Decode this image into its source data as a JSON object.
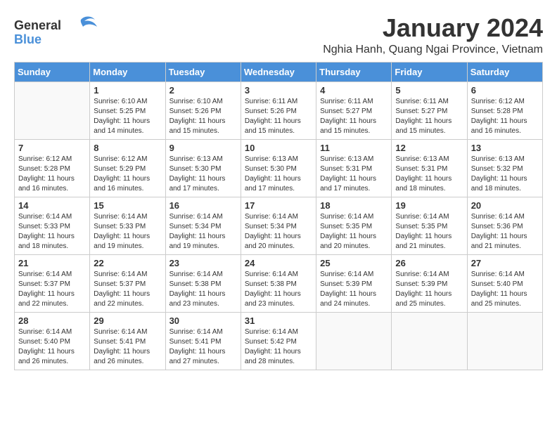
{
  "header": {
    "logo_general": "General",
    "logo_blue": "Blue",
    "month": "January 2024",
    "location": "Nghia Hanh, Quang Ngai Province, Vietnam"
  },
  "weekdays": [
    "Sunday",
    "Monday",
    "Tuesday",
    "Wednesday",
    "Thursday",
    "Friday",
    "Saturday"
  ],
  "weeks": [
    [
      {
        "day": "",
        "sunrise": "",
        "sunset": "",
        "daylight": ""
      },
      {
        "day": "1",
        "sunrise": "Sunrise: 6:10 AM",
        "sunset": "Sunset: 5:25 PM",
        "daylight": "Daylight: 11 hours and 14 minutes."
      },
      {
        "day": "2",
        "sunrise": "Sunrise: 6:10 AM",
        "sunset": "Sunset: 5:26 PM",
        "daylight": "Daylight: 11 hours and 15 minutes."
      },
      {
        "day": "3",
        "sunrise": "Sunrise: 6:11 AM",
        "sunset": "Sunset: 5:26 PM",
        "daylight": "Daylight: 11 hours and 15 minutes."
      },
      {
        "day": "4",
        "sunrise": "Sunrise: 6:11 AM",
        "sunset": "Sunset: 5:27 PM",
        "daylight": "Daylight: 11 hours and 15 minutes."
      },
      {
        "day": "5",
        "sunrise": "Sunrise: 6:11 AM",
        "sunset": "Sunset: 5:27 PM",
        "daylight": "Daylight: 11 hours and 15 minutes."
      },
      {
        "day": "6",
        "sunrise": "Sunrise: 6:12 AM",
        "sunset": "Sunset: 5:28 PM",
        "daylight": "Daylight: 11 hours and 16 minutes."
      }
    ],
    [
      {
        "day": "7",
        "sunrise": "Sunrise: 6:12 AM",
        "sunset": "Sunset: 5:28 PM",
        "daylight": "Daylight: 11 hours and 16 minutes."
      },
      {
        "day": "8",
        "sunrise": "Sunrise: 6:12 AM",
        "sunset": "Sunset: 5:29 PM",
        "daylight": "Daylight: 11 hours and 16 minutes."
      },
      {
        "day": "9",
        "sunrise": "Sunrise: 6:13 AM",
        "sunset": "Sunset: 5:30 PM",
        "daylight": "Daylight: 11 hours and 17 minutes."
      },
      {
        "day": "10",
        "sunrise": "Sunrise: 6:13 AM",
        "sunset": "Sunset: 5:30 PM",
        "daylight": "Daylight: 11 hours and 17 minutes."
      },
      {
        "day": "11",
        "sunrise": "Sunrise: 6:13 AM",
        "sunset": "Sunset: 5:31 PM",
        "daylight": "Daylight: 11 hours and 17 minutes."
      },
      {
        "day": "12",
        "sunrise": "Sunrise: 6:13 AM",
        "sunset": "Sunset: 5:31 PM",
        "daylight": "Daylight: 11 hours and 18 minutes."
      },
      {
        "day": "13",
        "sunrise": "Sunrise: 6:13 AM",
        "sunset": "Sunset: 5:32 PM",
        "daylight": "Daylight: 11 hours and 18 minutes."
      }
    ],
    [
      {
        "day": "14",
        "sunrise": "Sunrise: 6:14 AM",
        "sunset": "Sunset: 5:33 PM",
        "daylight": "Daylight: 11 hours and 18 minutes."
      },
      {
        "day": "15",
        "sunrise": "Sunrise: 6:14 AM",
        "sunset": "Sunset: 5:33 PM",
        "daylight": "Daylight: 11 hours and 19 minutes."
      },
      {
        "day": "16",
        "sunrise": "Sunrise: 6:14 AM",
        "sunset": "Sunset: 5:34 PM",
        "daylight": "Daylight: 11 hours and 19 minutes."
      },
      {
        "day": "17",
        "sunrise": "Sunrise: 6:14 AM",
        "sunset": "Sunset: 5:34 PM",
        "daylight": "Daylight: 11 hours and 20 minutes."
      },
      {
        "day": "18",
        "sunrise": "Sunrise: 6:14 AM",
        "sunset": "Sunset: 5:35 PM",
        "daylight": "Daylight: 11 hours and 20 minutes."
      },
      {
        "day": "19",
        "sunrise": "Sunrise: 6:14 AM",
        "sunset": "Sunset: 5:35 PM",
        "daylight": "Daylight: 11 hours and 21 minutes."
      },
      {
        "day": "20",
        "sunrise": "Sunrise: 6:14 AM",
        "sunset": "Sunset: 5:36 PM",
        "daylight": "Daylight: 11 hours and 21 minutes."
      }
    ],
    [
      {
        "day": "21",
        "sunrise": "Sunrise: 6:14 AM",
        "sunset": "Sunset: 5:37 PM",
        "daylight": "Daylight: 11 hours and 22 minutes."
      },
      {
        "day": "22",
        "sunrise": "Sunrise: 6:14 AM",
        "sunset": "Sunset: 5:37 PM",
        "daylight": "Daylight: 11 hours and 22 minutes."
      },
      {
        "day": "23",
        "sunrise": "Sunrise: 6:14 AM",
        "sunset": "Sunset: 5:38 PM",
        "daylight": "Daylight: 11 hours and 23 minutes."
      },
      {
        "day": "24",
        "sunrise": "Sunrise: 6:14 AM",
        "sunset": "Sunset: 5:38 PM",
        "daylight": "Daylight: 11 hours and 23 minutes."
      },
      {
        "day": "25",
        "sunrise": "Sunrise: 6:14 AM",
        "sunset": "Sunset: 5:39 PM",
        "daylight": "Daylight: 11 hours and 24 minutes."
      },
      {
        "day": "26",
        "sunrise": "Sunrise: 6:14 AM",
        "sunset": "Sunset: 5:39 PM",
        "daylight": "Daylight: 11 hours and 25 minutes."
      },
      {
        "day": "27",
        "sunrise": "Sunrise: 6:14 AM",
        "sunset": "Sunset: 5:40 PM",
        "daylight": "Daylight: 11 hours and 25 minutes."
      }
    ],
    [
      {
        "day": "28",
        "sunrise": "Sunrise: 6:14 AM",
        "sunset": "Sunset: 5:40 PM",
        "daylight": "Daylight: 11 hours and 26 minutes."
      },
      {
        "day": "29",
        "sunrise": "Sunrise: 6:14 AM",
        "sunset": "Sunset: 5:41 PM",
        "daylight": "Daylight: 11 hours and 26 minutes."
      },
      {
        "day": "30",
        "sunrise": "Sunrise: 6:14 AM",
        "sunset": "Sunset: 5:41 PM",
        "daylight": "Daylight: 11 hours and 27 minutes."
      },
      {
        "day": "31",
        "sunrise": "Sunrise: 6:14 AM",
        "sunset": "Sunset: 5:42 PM",
        "daylight": "Daylight: 11 hours and 28 minutes."
      },
      {
        "day": "",
        "sunrise": "",
        "sunset": "",
        "daylight": ""
      },
      {
        "day": "",
        "sunrise": "",
        "sunset": "",
        "daylight": ""
      },
      {
        "day": "",
        "sunrise": "",
        "sunset": "",
        "daylight": ""
      }
    ]
  ]
}
